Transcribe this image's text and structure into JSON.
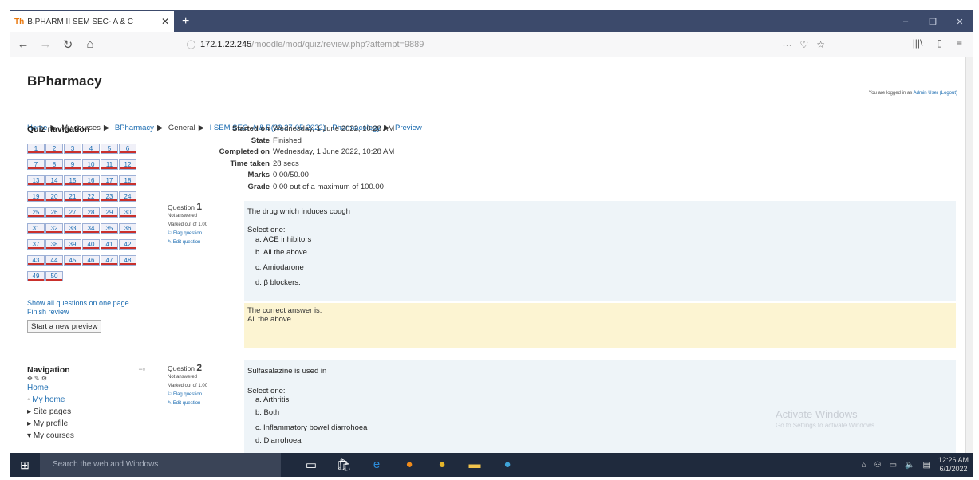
{
  "browser": {
    "tab_title": "B.PHARM II SEM SEC- A & C",
    "tab_favicon": "Th",
    "url_host": "172.1.22.245",
    "url_path": "/moodle/mod/quiz/review.php?attempt=9889"
  },
  "site": {
    "title": "BPharmacy",
    "logged_in_prefix": "You are logged in as",
    "logged_in_user": "Admin User",
    "logout": "(Logout)"
  },
  "breadcrumb": [
    "Home",
    "My courses",
    "BPharmacy",
    "General",
    "I SEM SEC- A & B(23.27-05-2022) - Pharmacology",
    "Preview"
  ],
  "quiz_nav": {
    "title": "Quiz navigation",
    "questions": [
      "1",
      "2",
      "3",
      "4",
      "5",
      "6",
      "7",
      "8",
      "9",
      "10",
      "11",
      "12",
      "13",
      "14",
      "15",
      "16",
      "17",
      "18",
      "19",
      "20",
      "21",
      "22",
      "23",
      "24",
      "25",
      "26",
      "27",
      "28",
      "29",
      "30",
      "31",
      "32",
      "33",
      "34",
      "35",
      "36",
      "37",
      "38",
      "39",
      "40",
      "41",
      "42",
      "43",
      "44",
      "45",
      "46",
      "47",
      "48",
      "49",
      "50"
    ],
    "show_all": "Show all questions on one page",
    "finish_review": "Finish review",
    "start_new": "Start a new preview"
  },
  "navigation": {
    "title": "Navigation",
    "home": "Home",
    "my_home": "My home",
    "site_pages": "Site pages",
    "my_profile": "My profile",
    "my_courses": "My courses"
  },
  "summary": [
    {
      "label": "Started on",
      "value": "Wednesday, 1 June 2022, 10:28 AM"
    },
    {
      "label": "State",
      "value": "Finished"
    },
    {
      "label": "Completed on",
      "value": "Wednesday, 1 June 2022, 10:28 AM"
    },
    {
      "label": "Time taken",
      "value": "28 secs"
    },
    {
      "label": "Marks",
      "value": "0.00/50.00"
    },
    {
      "label": "Grade",
      "value": "0.00 out of a maximum of 100.00"
    }
  ],
  "questions": [
    {
      "label": "Question",
      "number": "1",
      "status": "Not answered",
      "marked": "Marked out of 1.00",
      "flag": "Flag question",
      "edit": "Edit question",
      "text": "The drug which induces cough",
      "select_one": "Select one:",
      "options": [
        "a. ACE inhibitors",
        "b. All the above",
        "c. Amiodarone",
        "d. β blockers."
      ],
      "correct_label": "The correct answer is:",
      "correct_answer": "All the above"
    },
    {
      "label": "Question",
      "number": "2",
      "status": "Not answered",
      "marked": "Marked out of 1.00",
      "flag": "Flag question",
      "edit": "Edit question",
      "text": "Sulfasalazine is used in",
      "select_one": "Select one:",
      "options": [
        "a. Arthritis",
        "b. Both",
        "c. Inflammatory bowel diarrohoea",
        "d. Diarrohoea"
      ]
    }
  ],
  "watermark": {
    "title": "Activate Windows",
    "sub": "Go to Settings to activate Windows."
  },
  "taskbar": {
    "search": "Search the web and Windows",
    "time": "12:26 AM",
    "date": "6/1/2022"
  }
}
